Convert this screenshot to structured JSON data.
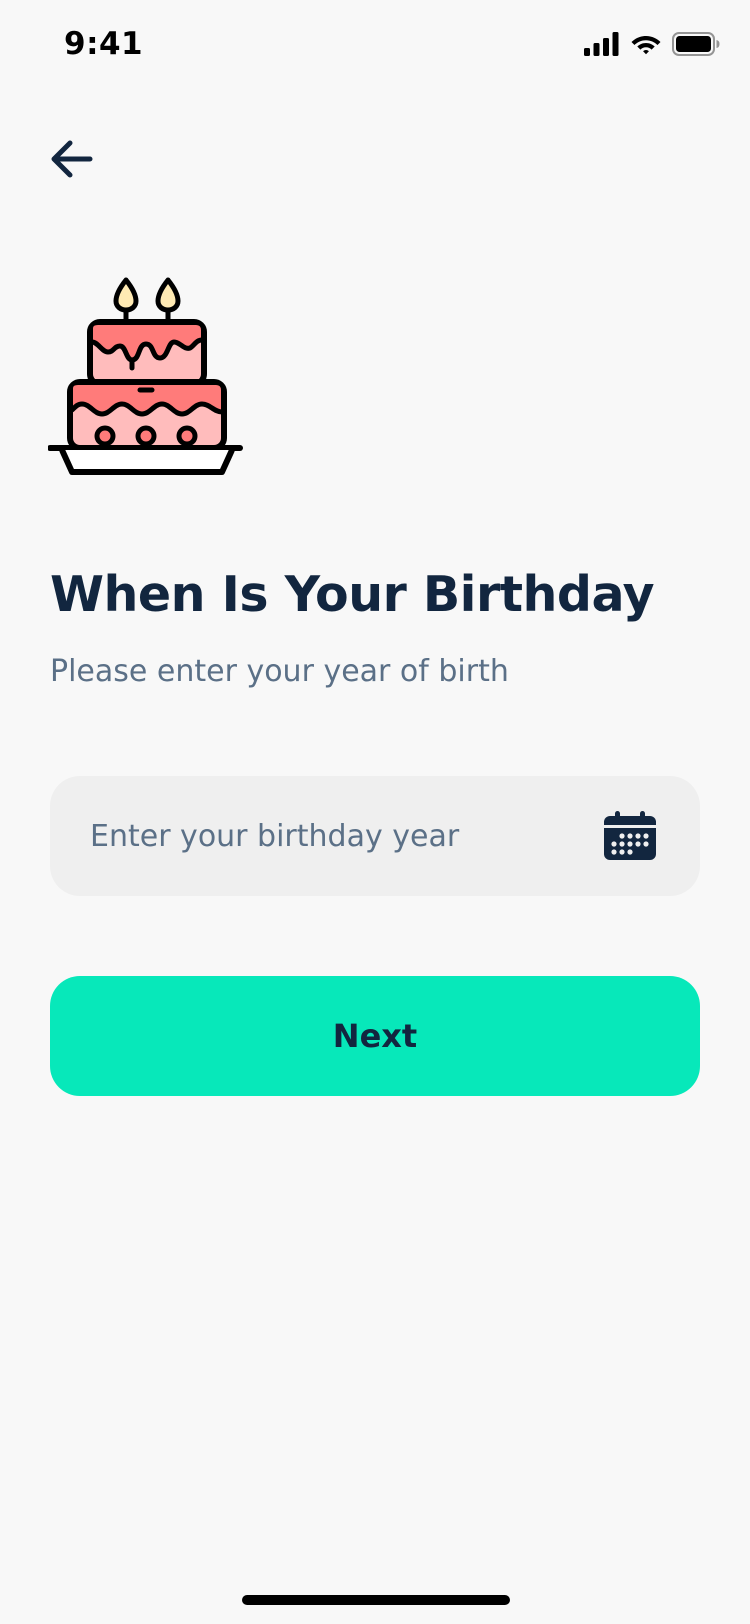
{
  "status_bar": {
    "time": "9:41",
    "icons": [
      "cellular-signal-icon",
      "wifi-icon",
      "battery-icon"
    ]
  },
  "header": {
    "back_icon": "arrow-left-icon"
  },
  "illustration": {
    "icon": "birthday-cake-icon",
    "colors": {
      "frosting": "#FF7B7A",
      "cake": "#FFBCBC",
      "flame": "#FFEAB3",
      "outline": "#000000"
    }
  },
  "title": "When Is Your Birthday",
  "subtitle": "Please enter your year of birth",
  "year_field": {
    "value": "",
    "placeholder": "Enter your birthday year",
    "icon": "calendar-icon"
  },
  "next_button": {
    "label": "Next"
  },
  "colors": {
    "background": "#F8F8F8",
    "primary_text": "#12263F",
    "secondary_text": "#5B7087",
    "accent": "#07E8BA",
    "input_background": "#EFEFEF"
  }
}
